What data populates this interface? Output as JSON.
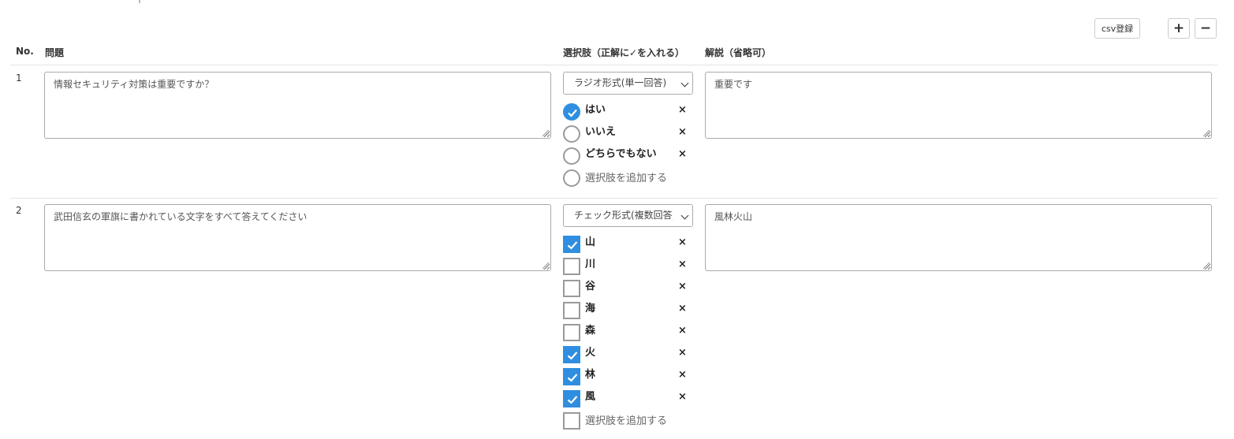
{
  "toolbar": {
    "csv_label": "csv登録",
    "plus_label": "+",
    "minus_label": "−"
  },
  "header": {
    "no": "No.",
    "question": "問題",
    "choices": "選択肢（正解に✓を入れる）",
    "explanation": "解説（省略可）"
  },
  "questions": [
    {
      "number": "1",
      "question_text": "情報セキュリティ対策は重要ですか？",
      "choice_type": "ラジオ形式(単一回答)",
      "options": [
        {
          "label": "はい",
          "checked": true
        },
        {
          "label": "いいえ",
          "checked": false
        },
        {
          "label": "どちらでもない",
          "checked": false
        }
      ],
      "add_option_label": "選択肢を追加する",
      "explanation_text": "重要です"
    },
    {
      "number": "2",
      "question_text": "武田信玄の軍旗に書かれている文字をすべて答えてください",
      "choice_type": "チェック形式(複数回答)",
      "options": [
        {
          "label": "山",
          "checked": true
        },
        {
          "label": "川",
          "checked": false
        },
        {
          "label": "谷",
          "checked": false
        },
        {
          "label": "海",
          "checked": false
        },
        {
          "label": "森",
          "checked": false
        },
        {
          "label": "火",
          "checked": true
        },
        {
          "label": "林",
          "checked": true
        },
        {
          "label": "風",
          "checked": true
        }
      ],
      "add_option_label": "選択肢を追加する",
      "explanation_text": "風林火山"
    }
  ],
  "delete_symbol": "×",
  "colors": {
    "accent": "#2f8ee0",
    "border": "#aaaaaa",
    "divider": "#e3e3e3"
  }
}
